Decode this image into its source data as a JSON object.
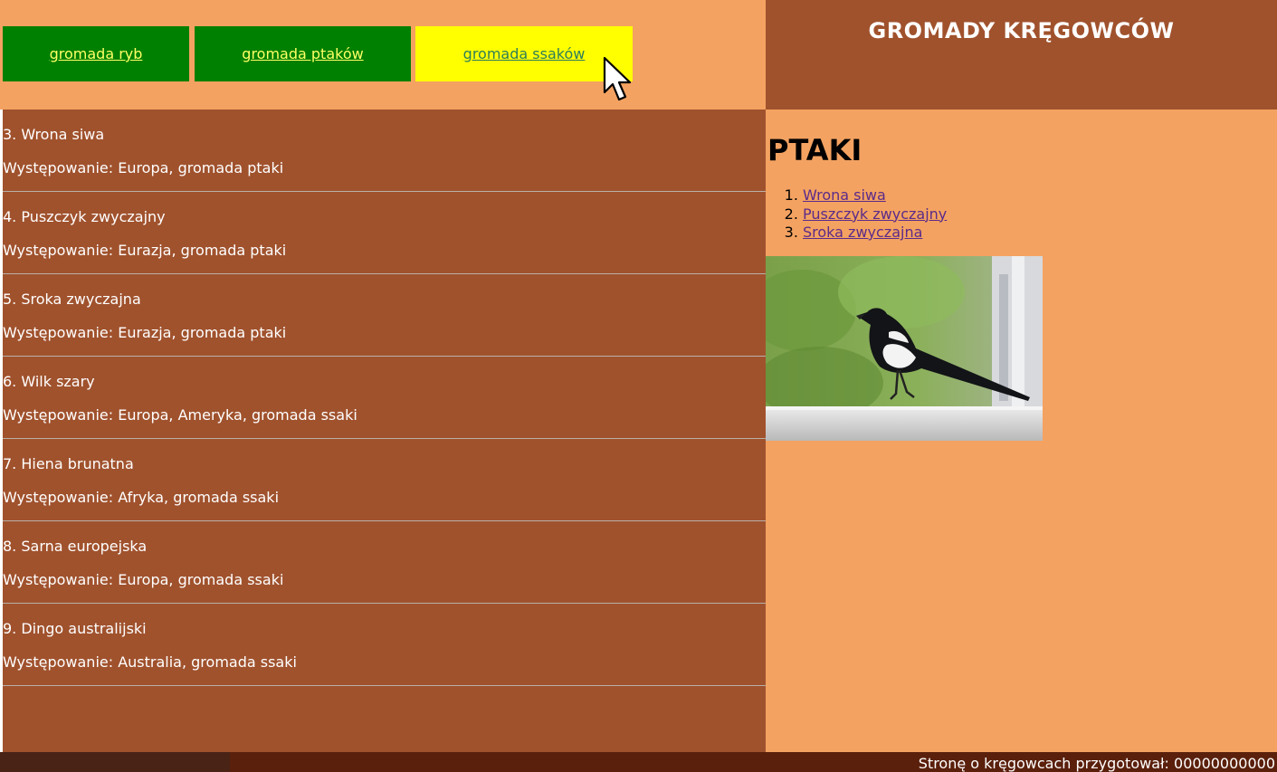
{
  "nav": {
    "items": [
      {
        "label": "gromada ryb"
      },
      {
        "label": "gromada ptaków"
      },
      {
        "label": "gromada ssaków",
        "state": "hovered"
      }
    ]
  },
  "header": {
    "title": "GROMADY KRĘGOWCÓW"
  },
  "main": {
    "entries": [
      {
        "name": "3. Wrona siwa",
        "occurrence": "Występowanie: Europa, gromada ptaki"
      },
      {
        "name": "4. Puszczyk zwyczajny",
        "occurrence": "Występowanie: Eurazja, gromada ptaki"
      },
      {
        "name": "5. Sroka zwyczajna",
        "occurrence": "Występowanie: Eurazja, gromada ptaki"
      },
      {
        "name": "6. Wilk szary",
        "occurrence": "Występowanie: Europa, Ameryka, gromada ssaki"
      },
      {
        "name": "7. Hiena brunatna",
        "occurrence": "Występowanie: Afryka, gromada ssaki"
      },
      {
        "name": "8. Sarna europejska",
        "occurrence": "Występowanie: Europa, gromada ssaki"
      },
      {
        "name": "9. Dingo australijski",
        "occurrence": "Występowanie: Australia, gromada ssaki"
      }
    ]
  },
  "side": {
    "heading": "PTAKI",
    "links": [
      {
        "label": "Wrona siwa"
      },
      {
        "label": "Puszczyk zwyczajny"
      },
      {
        "label": "Sroka zwyczajna"
      }
    ],
    "photo_subject": "magpie"
  },
  "footer": {
    "text": "Stronę o kręgowcach przygotował: 00000000000"
  },
  "colors": {
    "page_bg": "#f4a261",
    "panel_brown": "#a0522d",
    "nav_green": "#008000",
    "nav_active": "#ffff00",
    "footer_bg": "#5a200c"
  }
}
